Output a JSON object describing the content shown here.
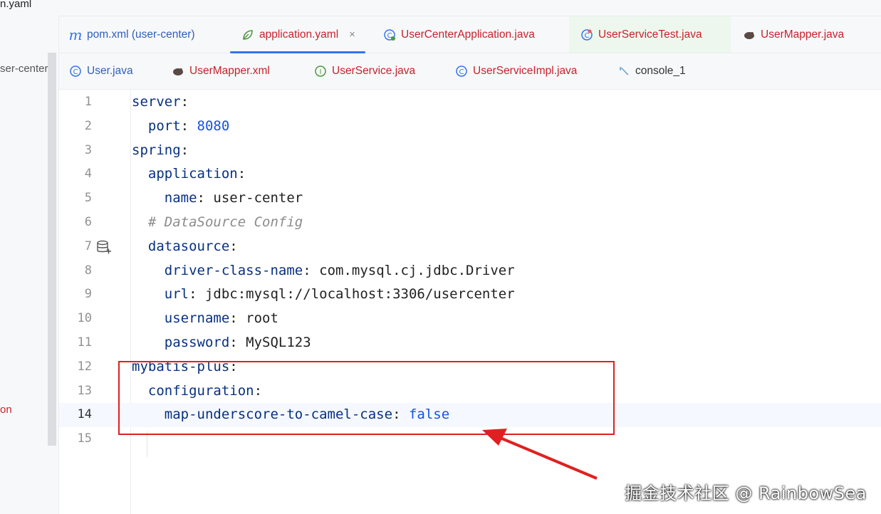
{
  "window": {
    "title_fragment": "n.yaml"
  },
  "sidebar": {
    "project_label": "ser-center",
    "item_fragment": "on"
  },
  "tabs_row1": [
    {
      "label": "pom.xml (user-center)",
      "icon": "maven-m-icon",
      "active": false
    },
    {
      "label": "application.yaml",
      "icon": "yaml-leaf-icon",
      "active": true,
      "close": "×"
    },
    {
      "label": "UserCenterApplication.java",
      "icon": "spring-class-icon",
      "active": false
    },
    {
      "label": "UserServiceTest.java",
      "icon": "test-class-icon",
      "active": false
    },
    {
      "label": "UserMapper.java",
      "icon": "mybatis-bird-icon",
      "active": false
    }
  ],
  "tabs_row2": [
    {
      "label": "User.java",
      "icon": "class-icon"
    },
    {
      "label": "UserMapper.xml",
      "icon": "mybatis-bird-icon"
    },
    {
      "label": "UserService.java",
      "icon": "interface-icon"
    },
    {
      "label": "UserServiceImpl.java",
      "icon": "class-icon"
    },
    {
      "label": "console_1",
      "icon": "console-icon"
    }
  ],
  "editor": {
    "current_line": 14,
    "lines": [
      {
        "n": "1",
        "indent": "",
        "key": "server",
        "sep": ":",
        "value": ""
      },
      {
        "n": "2",
        "indent": "  ",
        "key": "port",
        "sep": ": ",
        "value": "8080"
      },
      {
        "n": "3",
        "indent": "",
        "key": "spring",
        "sep": ":",
        "value": ""
      },
      {
        "n": "4",
        "indent": "  ",
        "key": "application",
        "sep": ":",
        "value": ""
      },
      {
        "n": "5",
        "indent": "    ",
        "key": "name",
        "sep": ": ",
        "value": "user-center"
      },
      {
        "n": "6",
        "indent": "  ",
        "comment": "# DataSource Config"
      },
      {
        "n": "7",
        "indent": "  ",
        "key": "datasource",
        "sep": ":",
        "value": ""
      },
      {
        "n": "8",
        "indent": "    ",
        "key": "driver-class-name",
        "sep": ": ",
        "value": "com.mysql.cj.jdbc.Driver"
      },
      {
        "n": "9",
        "indent": "    ",
        "key": "url",
        "sep": ": ",
        "value": "jdbc:mysql://localhost:3306/usercenter"
      },
      {
        "n": "10",
        "indent": "    ",
        "key": "username",
        "sep": ": ",
        "value": "root"
      },
      {
        "n": "11",
        "indent": "    ",
        "key": "password",
        "sep": ": ",
        "value": "MySQL123"
      },
      {
        "n": "12",
        "indent": "",
        "key": "mybatis-plus",
        "sep": ":",
        "value": ""
      },
      {
        "n": "13",
        "indent": "  ",
        "key": "configuration",
        "sep": ":",
        "value": ""
      },
      {
        "n": "14",
        "indent": "    ",
        "key": "map-underscore-to-camel-case",
        "sep": ": ",
        "value": "false"
      },
      {
        "n": "15",
        "indent": "",
        "key": "",
        "sep": "",
        "value": ""
      }
    ]
  },
  "annotation": {
    "box_color": "#e02020",
    "arrow_color": "#e02020"
  },
  "watermark": "掘金技术社区 @ RainbowSea"
}
